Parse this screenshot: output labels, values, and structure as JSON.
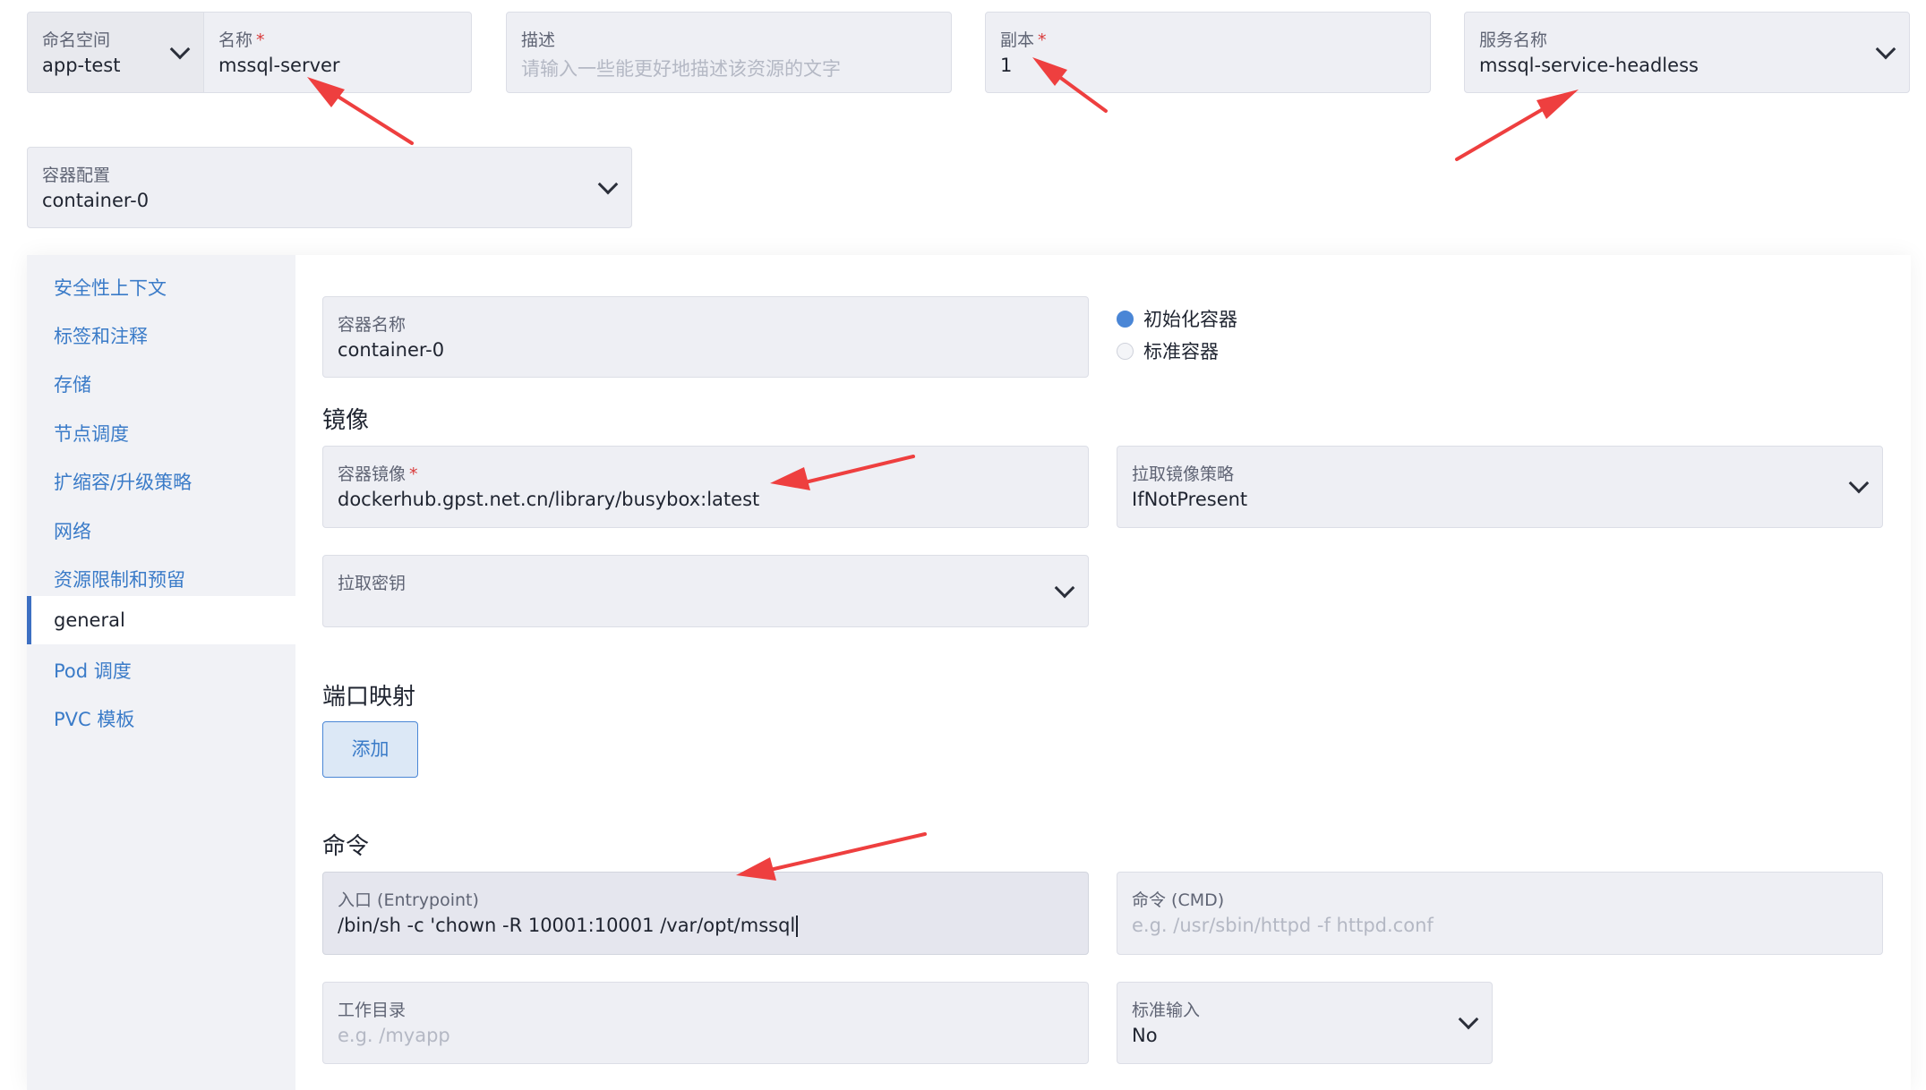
{
  "top_row": {
    "namespace": {
      "label": "命名空间",
      "value": "app-test"
    },
    "name": {
      "label": "名称",
      "required_mark": "*",
      "value": "mssql-server"
    },
    "description": {
      "label": "描述",
      "placeholder": "请输入一些能更好地描述该资源的文字"
    },
    "replicas": {
      "label": "副本",
      "required_mark": "*",
      "value": "1"
    },
    "service_name": {
      "label": "服务名称",
      "value": "mssql-service-headless"
    }
  },
  "container_config": {
    "label": "容器配置",
    "value": "container-0"
  },
  "sidebar": {
    "items": [
      {
        "label": "安全性上下文"
      },
      {
        "label": "标签和注释"
      },
      {
        "label": "存储"
      },
      {
        "label": "节点调度"
      },
      {
        "label": "扩缩容/升级策略"
      },
      {
        "label": "网络"
      },
      {
        "label": "资源限制和预留"
      },
      {
        "label": "general"
      },
      {
        "label": "Pod 调度"
      },
      {
        "label": "PVC 模板"
      }
    ],
    "active_index": 7
  },
  "container_name": {
    "label": "容器名称",
    "value": "container-0"
  },
  "container_type": {
    "options": [
      "初始化容器",
      "标准容器"
    ],
    "selected": "初始化容器"
  },
  "image_section": {
    "title": "镜像",
    "image": {
      "label": "容器镜像",
      "required_mark": "*",
      "value": "dockerhub.gpst.net.cn/library/busybox:latest"
    },
    "pull_policy": {
      "label": "拉取镜像策略",
      "value": "IfNotPresent"
    },
    "pull_secret": {
      "label": "拉取密钥",
      "value": ""
    }
  },
  "ports_section": {
    "title": "端口映射",
    "add_label": "添加"
  },
  "command_section": {
    "title": "命令",
    "entrypoint": {
      "label": "入口 (Entrypoint)",
      "value": "/bin/sh -c 'chown -R 10001:10001 /var/opt/mssql"
    },
    "cmd": {
      "label": "命令 (CMD)",
      "placeholder": "e.g. /usr/sbin/httpd -f httpd.conf"
    },
    "workdir": {
      "label": "工作目录",
      "placeholder": "e.g. /myapp"
    },
    "stdin": {
      "label": "标准输入",
      "value": "No"
    }
  },
  "annotation_color": "#ee3f3f",
  "accent_color": "#3a7bc8"
}
